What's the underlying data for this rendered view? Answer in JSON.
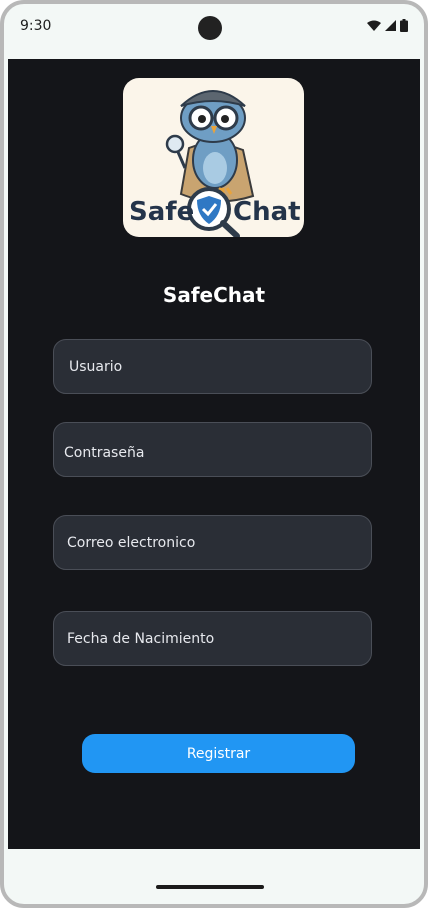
{
  "status_bar": {
    "time": "9:30",
    "icons": [
      "wifi-icon",
      "signal-icon",
      "battery-icon"
    ]
  },
  "logo": {
    "text_left": "Safe",
    "text_right": "Chat",
    "image": "owl-detective-with-magnifier-and-shield"
  },
  "app_title": "SafeChat",
  "form": {
    "fields": [
      {
        "label": "Usuario"
      },
      {
        "label": "Contraseña"
      },
      {
        "label": "Correo electronico"
      },
      {
        "label": "Fecha de Nacimiento"
      }
    ],
    "submit_label": "Registrar"
  },
  "colors": {
    "background": "#141519",
    "field_background": "#2a2e36",
    "field_border": "#4a4e57",
    "button": "#2196f3",
    "system_bar": "#f3f8f6"
  }
}
